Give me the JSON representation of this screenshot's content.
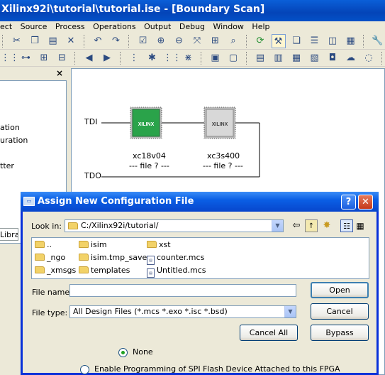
{
  "window": {
    "title": "Xilinx92i\\tutorial\\tutorial.ise - [Boundary Scan]"
  },
  "menu": [
    "ect",
    "Source",
    "Process",
    "Operations",
    "Output",
    "Debug",
    "Window",
    "Help"
  ],
  "left_panel": {
    "close": "×",
    "lines": [
      "ation",
      "uration",
      "tter"
    ],
    "tab_label": "Librar"
  },
  "chain": {
    "tdi_label": "TDI",
    "tdo_label": "TDO",
    "devices": [
      {
        "name": "xc18v04",
        "file": "--- file ? ---",
        "logo": "XILINX"
      },
      {
        "name": "xc3s400",
        "file": "--- file ? ---",
        "logo": "XILINX"
      }
    ],
    "colors": {
      "device1": "#2aa34a",
      "device2": "#d8d8d8"
    }
  },
  "dialog": {
    "title": "Assign New Configuration File",
    "help": "?",
    "close": "✕",
    "look_in_label": "Look in:",
    "look_in_value": "C:/Xilinx92i/tutorial/",
    "files": [
      {
        "name": "..",
        "kind": "folder"
      },
      {
        "name": "_ngo",
        "kind": "folder"
      },
      {
        "name": "_xmsgs",
        "kind": "folder"
      },
      {
        "name": "isim",
        "kind": "folder"
      },
      {
        "name": "isim.tmp_save",
        "kind": "folder"
      },
      {
        "name": "templates",
        "kind": "folder"
      },
      {
        "name": "xst",
        "kind": "folder"
      },
      {
        "name": "counter.mcs",
        "kind": "file"
      },
      {
        "name": "Untitled.mcs",
        "kind": "file"
      }
    ],
    "file_name_label": "File name:",
    "file_name_value": "",
    "file_type_label": "File type:",
    "file_type_value": "All Design Files (*.mcs *.exo *.isc *.bsd)",
    "open_button": "Open",
    "cancel_button": "Cancel",
    "cancel_all_button": "Cancel All",
    "bypass_button": "Bypass",
    "radio_none": "None",
    "radio_spi": "Enable Programming of SPI Flash Device Attached to this FPGA"
  }
}
